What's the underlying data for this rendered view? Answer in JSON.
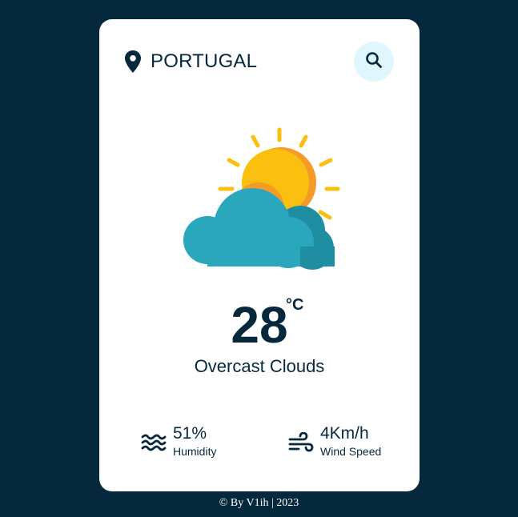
{
  "header": {
    "location": "PORTUGAL",
    "location_icon": "map-pin-icon",
    "search_icon": "search-icon"
  },
  "weather": {
    "illustration": "sun-behind-cloud-icon",
    "temperature": "28",
    "unit": "°C",
    "description": "Overcast Clouds"
  },
  "details": {
    "humidity": {
      "icon": "water-waves-icon",
      "value": "51%",
      "label": "Humidity"
    },
    "wind": {
      "icon": "wind-icon",
      "value": "4Km/h",
      "label": "Wind Speed"
    }
  },
  "footer": {
    "credit": "© By V1ih | 2023"
  },
  "colors": {
    "page_background": "#06283d",
    "card_background": "#ffffff",
    "text_primary": "#06283d",
    "search_button_background": "#dff6ff",
    "sun": "#fbbf0f",
    "sun_shade": "#f49c27",
    "cloud": "#2ba7bd",
    "cloud_shade": "#1f8ea3"
  }
}
